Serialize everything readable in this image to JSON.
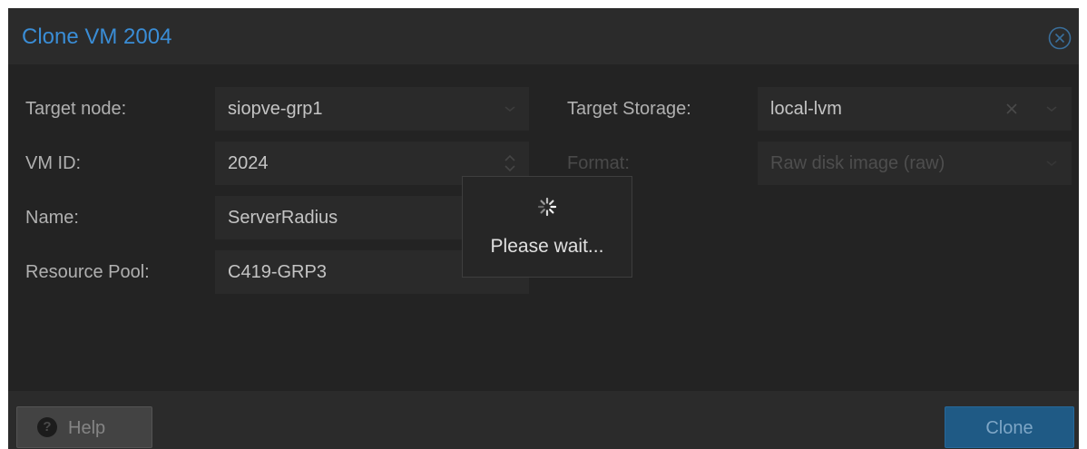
{
  "dialog": {
    "title": "Clone VM 2004",
    "close_icon": "close-circle-icon"
  },
  "form": {
    "target_node": {
      "label": "Target node:",
      "value": "siopve-grp1"
    },
    "vm_id": {
      "label": "VM ID:",
      "value": "2024"
    },
    "name": {
      "label": "Name:",
      "value": "ServerRadius"
    },
    "resource_pool": {
      "label": "Resource Pool:",
      "value": "C419-GRP3"
    },
    "target_storage": {
      "label": "Target Storage:",
      "value": "local-lvm"
    },
    "format": {
      "label": "Format:",
      "value": "Raw disk image (raw)"
    }
  },
  "loading": {
    "text": "Please wait...",
    "icon": "spinner-icon"
  },
  "footer": {
    "help_label": "Help",
    "help_icon": "question-circle-icon",
    "clone_label": "Clone"
  },
  "colors": {
    "title": "#3a8dd6",
    "primary_button": "#1f5a85",
    "background": "#2b2b2b"
  }
}
